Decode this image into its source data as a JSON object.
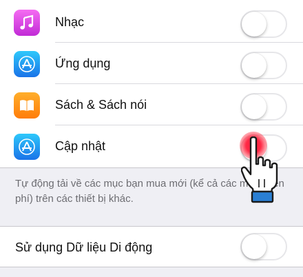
{
  "settings": {
    "rows": [
      {
        "label": "Nhạc",
        "icon": "music-note-icon"
      },
      {
        "label": "Ứng dụng",
        "icon": "app-store-icon"
      },
      {
        "label": "Sách & Sách nói",
        "icon": "books-icon"
      },
      {
        "label": "Cập nhật",
        "icon": "app-store-icon"
      }
    ],
    "footer": "Tự động tải về các mục bạn mua mới (kể cả các mục miễn phí) trên các thiết bị khác.",
    "cellular": {
      "label": "Sử dụng Dữ liệu Di động"
    }
  },
  "switches": {
    "music": false,
    "apps": false,
    "books": false,
    "updates": false,
    "cellular": false
  },
  "colors": {
    "background": "#efeff4",
    "tap_highlight": "#ff1e3c",
    "pointer_cuff": "#2a7fd4"
  }
}
